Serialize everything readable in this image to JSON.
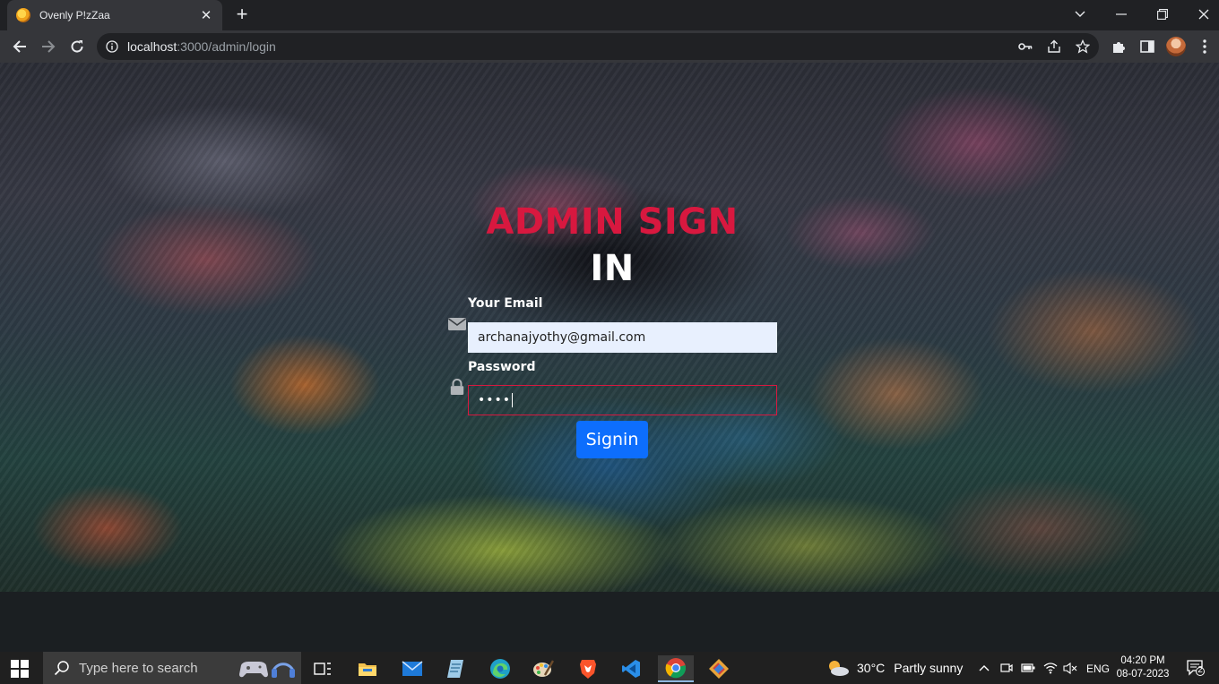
{
  "browser": {
    "tab_title": "Ovenly P!zZaa",
    "tab_close": "✕",
    "new_tab": "+",
    "url_host": "localhost",
    "url_path": ":3000/admin/login"
  },
  "login": {
    "title_red": "ADMIN SIGN",
    "title_white": "IN",
    "email_label": "Your Email",
    "email_value": "archanajyothy@gmail.com",
    "password_label": "Password",
    "password_masked": "••••",
    "signin_label": "Signin",
    "accent_color": "#d8183f",
    "button_color": "#0d6efd"
  },
  "taskbar": {
    "search_placeholder": "Type here to search",
    "weather_temp": "30°C",
    "weather_desc": "Partly sunny",
    "language": "ENG",
    "time": "04:20 PM",
    "date": "08-07-2023",
    "notification_count": "2",
    "apps": [
      "task-view-icon",
      "file-explorer-icon",
      "mail-icon",
      "notepad-icon",
      "edge-icon",
      "paint-icon",
      "brave-icon",
      "vscode-icon",
      "chrome-icon",
      "git-icon"
    ]
  }
}
